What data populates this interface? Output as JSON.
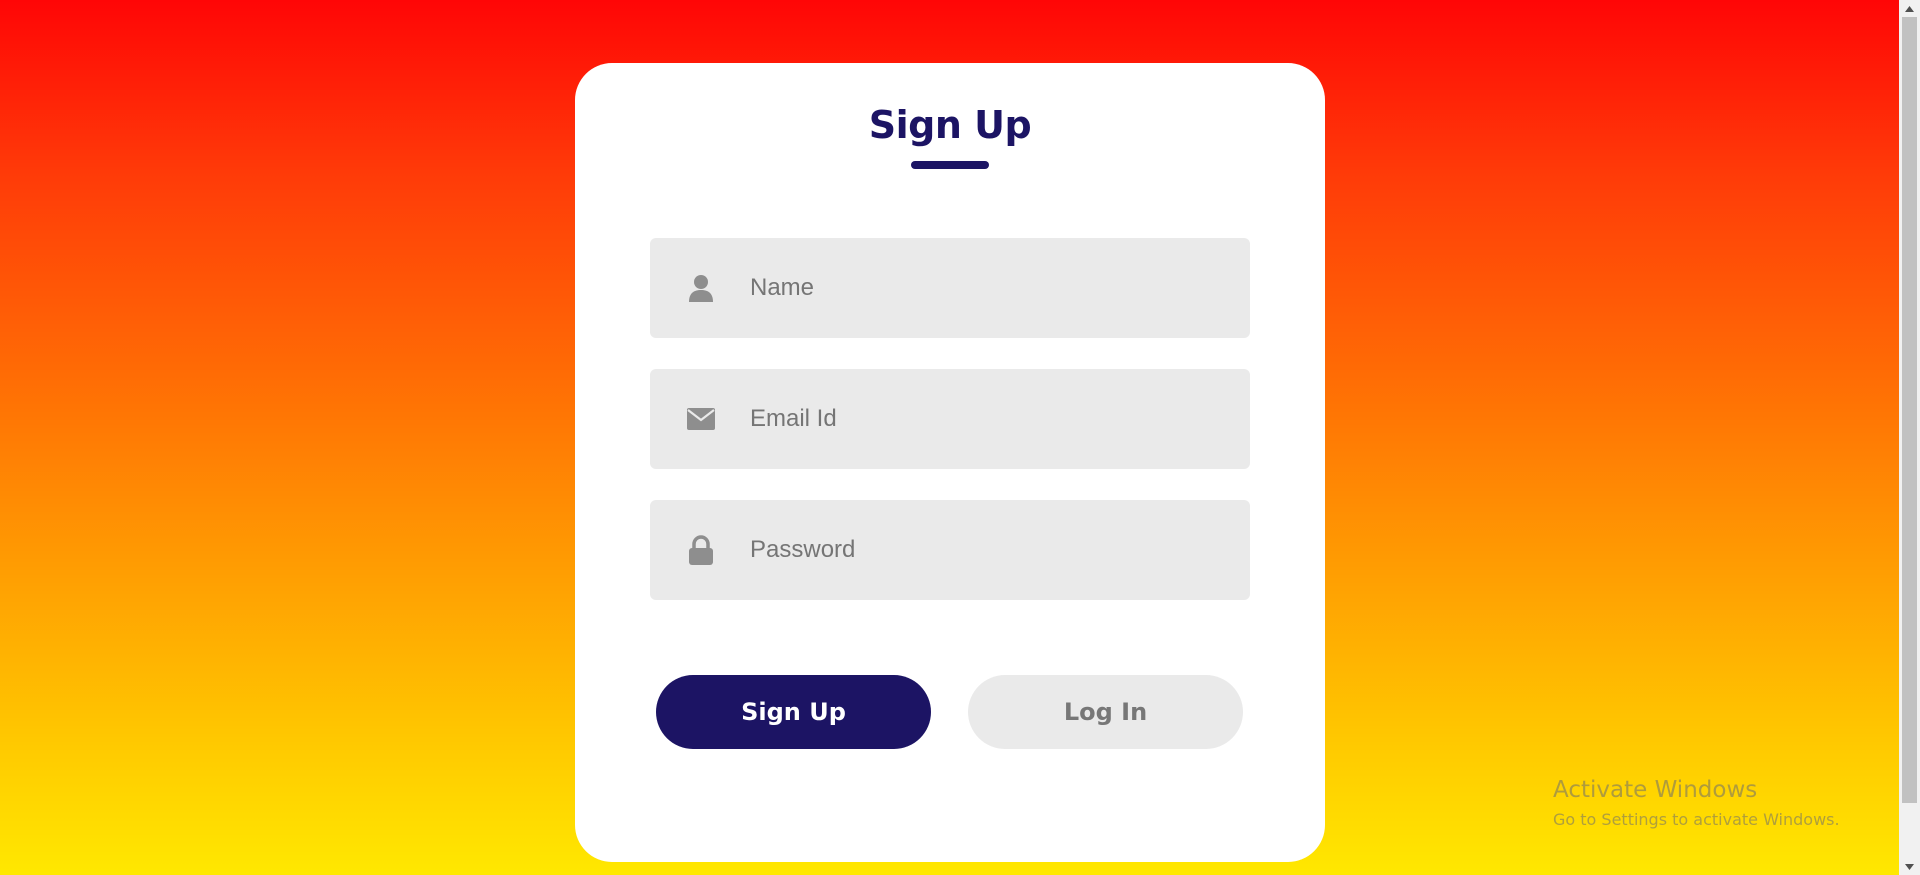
{
  "colors": {
    "accent": "#1c1464",
    "field_bg": "#eaeaea",
    "icon": "#8e8e8e",
    "gradient_top": "#ff0606",
    "gradient_bottom": "#ffe800"
  },
  "form": {
    "title": "Sign Up",
    "fields": [
      {
        "icon": "user-icon",
        "placeholder": "Name",
        "value": ""
      },
      {
        "icon": "envelope-icon",
        "placeholder": "Email Id",
        "value": ""
      },
      {
        "icon": "lock-icon",
        "placeholder": "Password",
        "value": ""
      }
    ],
    "signup_label": "Sign Up",
    "login_label": "Log In"
  },
  "watermark": {
    "title": "Activate Windows",
    "subtitle": "Go to Settings to activate Windows."
  }
}
